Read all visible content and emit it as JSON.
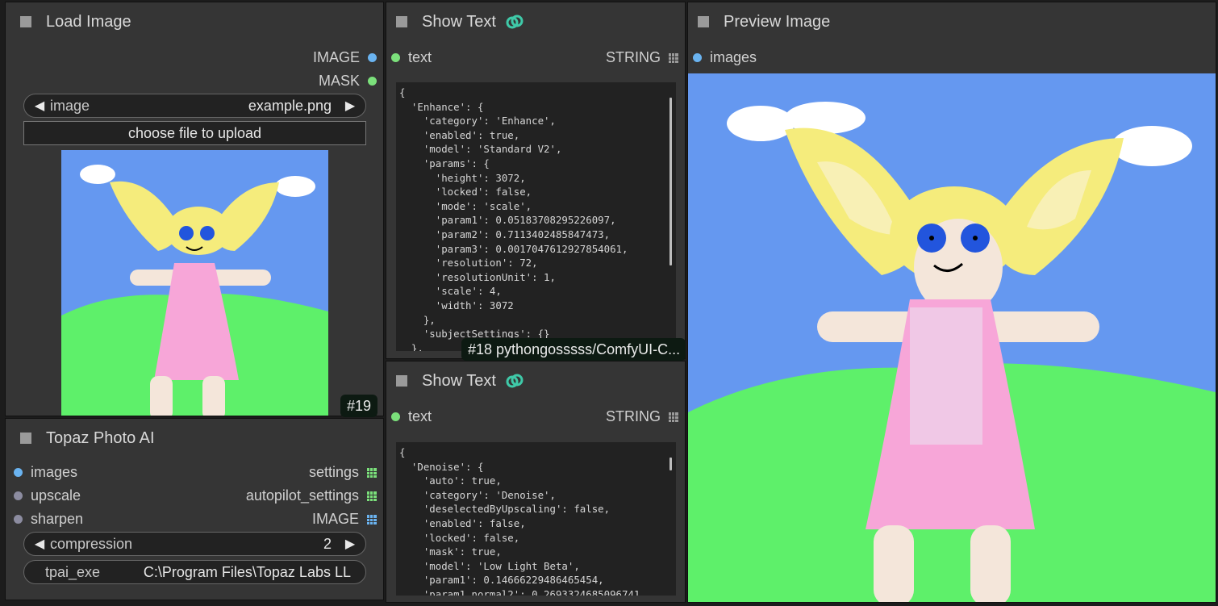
{
  "load_image": {
    "title": "Load Image",
    "outputs": [
      "IMAGE",
      "MASK"
    ],
    "image_widget": {
      "label": "image",
      "value": "example.png"
    },
    "upload_button": "choose file to upload",
    "badge": "#19"
  },
  "show_text_1": {
    "title": "Show Text",
    "input": "text",
    "output": "STRING",
    "lines": [
      "{",
      "  'Enhance': {",
      "    'category': 'Enhance',",
      "    'enabled': true,",
      "    'model': 'Standard V2',",
      "    'params': {",
      "      'height': 3072,",
      "      'locked': false,",
      "      'mode': 'scale',",
      "      'param1': 0.05183708295226097,",
      "      'param2': 0.7113402485847473,",
      "      'param3': 0.0017047612927854061,",
      "      'resolution': 72,",
      "      'resolutionUnit': 1,",
      "      'scale': 4,",
      "      'width': 3072",
      "    },",
      "    'subjectSettings': {}",
      "  },"
    ],
    "badge": "#18 pythongosssss/ComfyUI-C..."
  },
  "show_text_2": {
    "title": "Show Text",
    "input": "text",
    "output": "STRING",
    "lines": [
      "{",
      "  'Denoise': {",
      "    'auto': true,",
      "    'category': 'Denoise',",
      "    'deselectedByUpscaling': false,",
      "    'enabled': false,",
      "    'locked': false,",
      "    'mask': true,",
      "    'model': 'Low Light Beta',",
      "    'param1': 0.14666229486465454,",
      "    'param1_normal2': 0.2693324685096741"
    ]
  },
  "topaz": {
    "title": "Topaz Photo AI",
    "inputs": [
      "images",
      "upscale",
      "sharpen"
    ],
    "outputs": [
      "settings",
      "autopilot_settings",
      "IMAGE"
    ],
    "compression": {
      "label": "compression",
      "value": "2"
    },
    "tpai_exe": {
      "label": "tpai_exe",
      "value": "C:\\Program Files\\Topaz Labs LL"
    }
  },
  "preview": {
    "title": "Preview Image",
    "input": "images"
  },
  "colors": {
    "node_bg": "#353535",
    "canvas_bg": "#1c1c1c",
    "sky": "#6598f0",
    "grass": "#5ef06a",
    "hair": "#f5ec7c",
    "dress": "#f7a6d8",
    "skin": "#f4e6da",
    "eyes": "#2255dd"
  }
}
